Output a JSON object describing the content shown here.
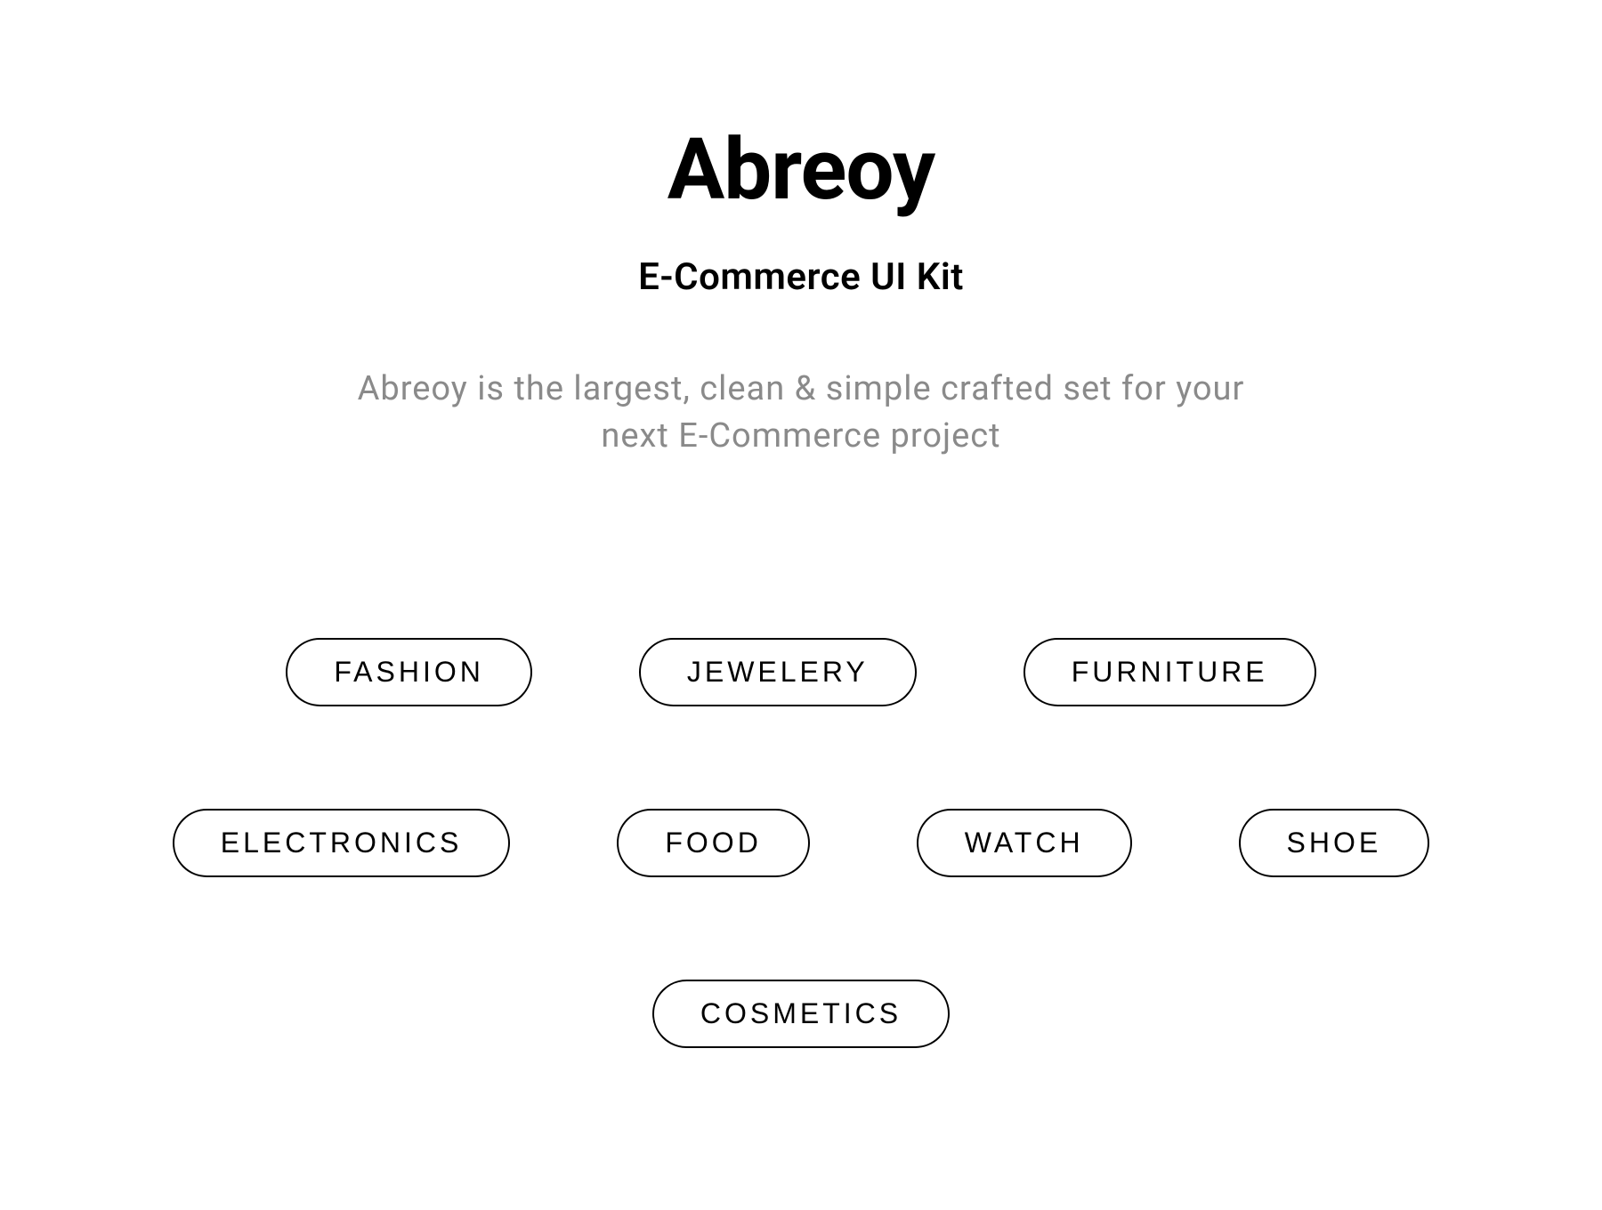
{
  "header": {
    "brand": "Abreoy",
    "subtitle": "E-Commerce UI Kit",
    "description": "Abreoy is the largest, clean & simple crafted set for your next  E-Commerce  project"
  },
  "categories": {
    "rows": [
      [
        "FASHION",
        "JEWELERY",
        "FURNITURE"
      ],
      [
        "ELECTRONICS",
        "FOOD",
        "WATCH",
        "SHOE"
      ],
      [
        "COSMETICS"
      ]
    ]
  }
}
